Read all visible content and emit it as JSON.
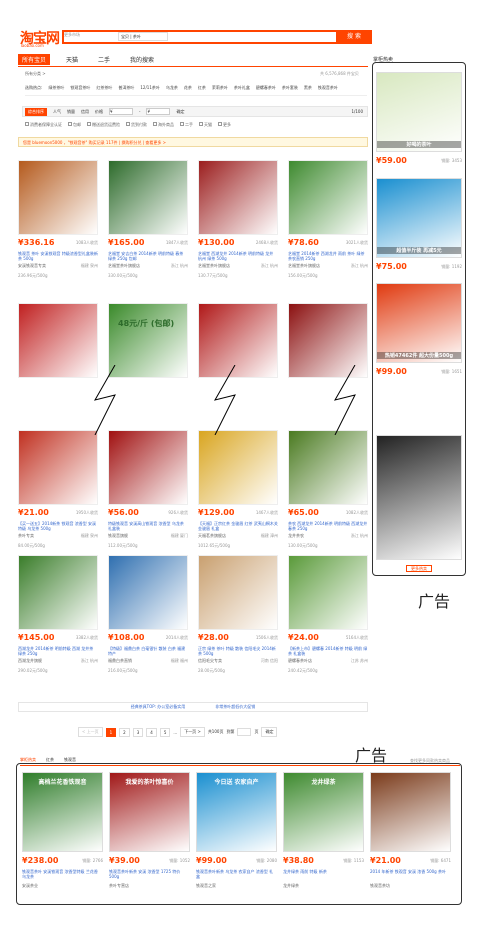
{
  "header": {
    "logo": "淘宝网",
    "logo_sub": "Taobao.com",
    "search_scope": "更多市场",
    "search_cat": "宝贝",
    "search_value": "茶叶",
    "search_button": "搜 索"
  },
  "nav": {
    "tabs": [
      "所有宝贝",
      "天猫",
      "二手",
      "我的搜索"
    ]
  },
  "crumb": "所有分类 >",
  "found": "共 6,576,868 件宝贝",
  "filters": [
    "选购热点:",
    "绿茶茶叶",
    "铁观音茶叶",
    "红茶茶叶",
    "普洱茶叶",
    "12/11茶叶",
    "乌龙茶",
    "花茶",
    "红茶",
    "茉莉茶叶",
    "茶叶礼盒",
    "碧螺春茶叶",
    "茶叶套装",
    "黑茶",
    "铁观音茶叶"
  ],
  "sortbar": {
    "items": [
      "综合排序",
      "人气",
      "销量",
      "信用",
      "价格",
      "¥",
      "-",
      "¥",
      "确定"
    ],
    "page": "1/100"
  },
  "checks": [
    "消费者保障全认证",
    "包邮",
    "赠送退货运费险",
    "货到付款",
    "海外商品",
    "二手",
    "天猫",
    "更多"
  ],
  "notice": {
    "text": "您是 bluemoon5000 ，\"铁观音茶\" 购买记录 117件 | 换购积分兑 | 查看更多 >"
  },
  "products": [
    {
      "price": "¥336.16",
      "deals": "1083人收货",
      "title": "铁观音 茶叶 安溪铁观音 特级浓香型礼盒装新茶 500g",
      "shop": "安溪铁观音专卖",
      "loc": "福建 泉州",
      "rate": "236.96元/500g",
      "img": "#b45a1d"
    },
    {
      "price": "¥165.00",
      "deals": "1847人收货",
      "title": "艺福堂 安吉白茶 2014新茶 明前特级 春茶 绿茶 250g 包邮",
      "shop": "艺福堂茶叶旗舰店",
      "loc": "浙江 杭州",
      "rate": "330.00元/500g",
      "img": "#2d6b2b"
    },
    {
      "price": "¥130.00",
      "deals": "2468人收货",
      "title": "艺福堂 西湖龙井 2014新茶 明前特级 龙井 杭州 绿茶 500g",
      "shop": "艺福堂茶叶旗舰店",
      "loc": "浙江 杭州",
      "rate": "130.77元/500g",
      "img": "#9b1e1e"
    },
    {
      "price": "¥78.60",
      "deals": "3021人收货",
      "title": "艺福堂 2014新茶 西湖龙井 雨前 茶叶 绿茶 茶农直销 250g",
      "shop": "艺福堂茶叶旗舰店",
      "loc": "浙江 杭州",
      "rate": "156.00元/500g",
      "img": "#3e8a2f"
    },
    {
      "price": "¥21.00",
      "deals": "1950人收货",
      "title": "【买一送五】2014新茶 铁观音 浓香型 安溪 特级 乌龙茶 500g",
      "shop": "茶叶专卖",
      "loc": "福建 泉州",
      "rate": "84.00元/500g",
      "img": "#c03020"
    },
    {
      "price": "¥56.00",
      "deals": "926人收货",
      "title": "特级铁观音 安溪高山铁观音 浓香型 乌龙茶 礼盒装",
      "shop": "铁观音旗舰",
      "loc": "福建 厦门",
      "rate": "112.00元/500g",
      "img": "#a01010"
    },
    {
      "price": "¥129.00",
      "deals": "1467人收货",
      "title": "【天福】正宗红茶 金骏眉 红茶 武夷山桐木关 金骏眉 礼盒",
      "shop": "天福茗茶旗舰店",
      "loc": "福建 漳州",
      "rate": "1012.65元/500g",
      "img": "#d9a520"
    },
    {
      "price": "¥65.00",
      "deals": "1082人收货",
      "title": "茶农 西湖龙井 2014新茶 明前特级 西湖龙井 春茶 250g",
      "shop": "龙井茶农",
      "loc": "浙江 杭州",
      "rate": "130.00元/500g",
      "img": "#4a7a20"
    },
    {
      "price": "¥145.00",
      "deals": "3382人收货",
      "title": "西湖龙井 2014新茶 明前特级 西湖 龙井茶 绿茶 250g",
      "shop": "西湖龙井旗舰",
      "loc": "浙江 杭州",
      "rate": "290.02元/500g",
      "img": "#3a7d2a"
    },
    {
      "price": "¥108.00",
      "deals": "2014人收货",
      "title": "【特级】福鼎白茶 白毫银针 散装 白茶 福建特产",
      "shop": "福鼎白茶直销",
      "loc": "福建 福州",
      "rate": "216.00元/500g",
      "img": "#2f6fb0"
    },
    {
      "price": "¥28.00",
      "deals": "1506人收货",
      "title": "正宗 绿茶 茶叶 特级 散装 信阳毛尖 2014新茶 500g",
      "shop": "信阳毛尖专卖",
      "loc": "河南 信阳",
      "rate": "28.00元/500g",
      "img": "#c9a070"
    },
    {
      "price": "¥24.00",
      "deals": "5164人收货",
      "title": "【新茶上市】碧螺春 2014新茶 特级 明前 绿茶 礼盒装",
      "shop": "碧螺春茶叶店",
      "loc": "江苏 苏州",
      "rate": "240.42元/500g",
      "img": "#5a9a3a"
    }
  ],
  "row2_labels": [
    "48元/斤 (包邮)"
  ],
  "ads_title": "掌柜热卖",
  "side_ads": [
    {
      "price": "¥59.00",
      "sales": "销量: 3453",
      "banner": "好喝的茶叶",
      "bg": "#d8e8c0"
    },
    {
      "price": "¥75.00",
      "sales": "销量: 1192",
      "banner": "超值半斤装 再减5元",
      "bg": "#1a8fd0"
    },
    {
      "price": "¥99.00",
      "sales": "销量: 1651",
      "banner": "热销47462件 超大份量500g",
      "bg": "#e03a10"
    },
    {
      "price": "",
      "sales": "",
      "banner": "",
      "bg": "#222"
    }
  ],
  "side_more": "更多热卖",
  "label_ad": "广告",
  "links": [
    "经典茶具TOP: 办公室必备实用",
    "非常茶叶超低价大促销"
  ],
  "pager": {
    "prev": "< 上一页",
    "pages": [
      "1",
      "2",
      "3",
      "4",
      "5",
      "..."
    ],
    "next": "下一页 >",
    "total": "共100页",
    "goto": "到第",
    "unit": "页",
    "ok": "确定"
  },
  "bottom": {
    "tabs": [
      "掌柜热卖",
      "红茶",
      "铁观音"
    ],
    "right": "查找更多同款热卖商品",
    "items": [
      {
        "price": "¥238.00",
        "sales": "销量: 2766",
        "title": "铁观音茶叶 安溪铁观音 浓香型特级 兰花香 乌龙茶",
        "shop": "安溪茶业",
        "top": "高档兰花香铁观音",
        "bg": "#2f7d2a"
      },
      {
        "price": "¥39.00",
        "sales": "销量: 1052",
        "title": "铁观音茶叶新茶 安溪 浓香型 1725 特价 500g",
        "shop": "茶叶专营店",
        "top": "我爱的茶叶惊喜价",
        "bg": "#a01818"
      },
      {
        "price": "¥99.00",
        "sales": "销量: 2080",
        "title": "铁观音茶叶新茶 乌龙茶 农家自产 浓香型 礼盒",
        "shop": "铁观音之家",
        "top": "今日送 农家自产",
        "bg": "#1a8fd0"
      },
      {
        "price": "¥38.80",
        "sales": "销量: 1153",
        "title": "龙井绿茶 雨前 特级 新茶",
        "shop": "龙井绿茶",
        "top": "龙井绿茶",
        "bg": "#3e8a2f"
      },
      {
        "price": "¥21.00",
        "sales": "销量: 6471",
        "title": "2014 年新茶 铁观音 安溪 浓香 500g 茶叶",
        "shop": "铁观音茶坊",
        "top": "",
        "bg": "#7a3a1a"
      }
    ]
  }
}
